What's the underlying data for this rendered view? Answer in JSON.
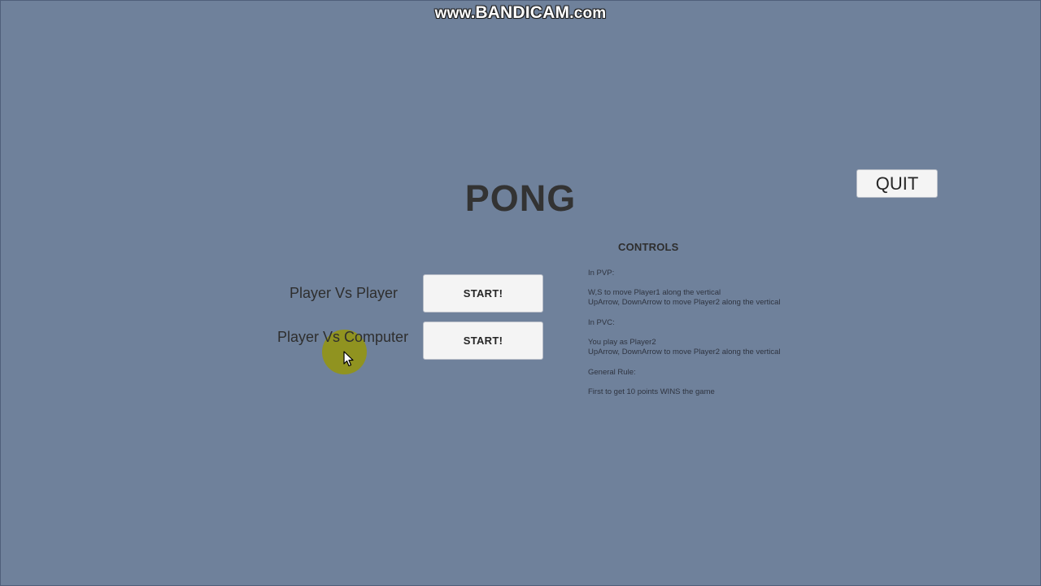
{
  "watermark": {
    "prefix": "www.",
    "brand": "BANDICAM",
    "suffix": ".com"
  },
  "game": {
    "title": "PONG"
  },
  "buttons": {
    "quit_label": "QUIT",
    "start_pvp_label": "START!",
    "start_pvc_label": "START!"
  },
  "modes": {
    "pvp_label": "Player Vs Player",
    "pvc_label": "Player Vs Computer"
  },
  "controls": {
    "heading": "CONTROLS",
    "pvp_header": "In PVP:",
    "pvp_line1": "W,S to move Player1 along the vertical",
    "pvp_line2": "UpArrow, DownArrow to move Player2 along the vertical",
    "pvc_header": "In PVC:",
    "pvc_line1": "You play as Player2",
    "pvc_line2": "UpArrow, DownArrow to move Player2 along the vertical",
    "rule_header": "General Rule:",
    "rule_line1": "First to get 10 points WINS the game"
  },
  "colors": {
    "background": "#6f819b",
    "button_bg": "#f4f4f4",
    "text_dark": "#333333",
    "cursor_highlight": "#96960a"
  },
  "icons": {
    "cursor": "mouse-pointer-icon"
  }
}
